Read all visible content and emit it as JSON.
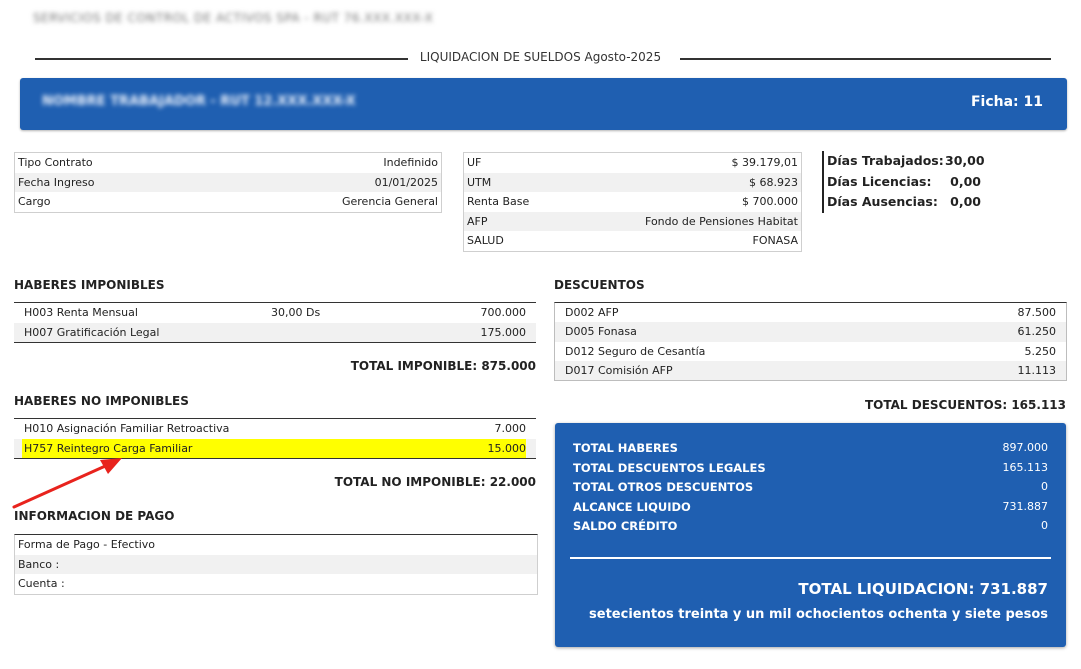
{
  "header": {
    "company_line": "SERVICIOS DE CONTROL DE ACTIVOS SPA - RUT 76.XXX.XXX-X",
    "document_title": "LIQUIDACION DE SUELDOS Agosto-2025"
  },
  "employee": {
    "name": "NOMBRE TRABAJADOR - RUT 12.XXX.XXX-X",
    "ficha_label": "Ficha:",
    "ficha_value": "11"
  },
  "contract_info": [
    {
      "label": "Tipo Contrato",
      "value": "Indefinido"
    },
    {
      "label": "Fecha Ingreso",
      "value": "01/01/2025"
    },
    {
      "label": "Cargo",
      "value": "Gerencia General"
    }
  ],
  "indicators": [
    {
      "label": "UF",
      "value": "$ 39.179,01"
    },
    {
      "label": "UTM",
      "value": "$ 68.923"
    },
    {
      "label": "Renta Base",
      "value": "$ 700.000"
    },
    {
      "label": "AFP",
      "value": "Fondo de Pensiones Habitat"
    },
    {
      "label": "SALUD",
      "value": "FONASA"
    }
  ],
  "days": [
    {
      "label": "Días Trabajados:",
      "value": "30,00"
    },
    {
      "label": "Días Licencias:",
      "value": "0,00"
    },
    {
      "label": "Días Ausencias:",
      "value": "0,00"
    }
  ],
  "haberes_imponibles": {
    "title": "HABERES IMPONIBLES",
    "rows": [
      {
        "name": "H003 Renta Mensual",
        "qty": "30,00 Ds",
        "amount": "700.000"
      },
      {
        "name": "H007 Gratificación Legal",
        "qty": "",
        "amount": "175.000"
      }
    ],
    "total": "TOTAL IMPONIBLE: 875.000"
  },
  "haberes_no_imponibles": {
    "title": "HABERES NO IMPONIBLES",
    "rows": [
      {
        "name": "H010 Asignación Familiar Retroactiva",
        "amount": "7.000"
      },
      {
        "name": "H757 Reintegro Carga Familiar",
        "amount": "15.000"
      }
    ],
    "total": "TOTAL NO IMPONIBLE: 22.000"
  },
  "pago": {
    "title": "INFORMACION DE PAGO",
    "rows": [
      "Forma de Pago - Efectivo",
      "Banco :",
      "Cuenta :"
    ]
  },
  "descuentos": {
    "title": "DESCUENTOS",
    "rows": [
      {
        "name": "D002 AFP",
        "amount": "87.500"
      },
      {
        "name": "D005 Fonasa",
        "amount": "61.250"
      },
      {
        "name": "D012 Seguro de Cesantía",
        "amount": "5.250"
      },
      {
        "name": "D017 Comisión AFP",
        "amount": "11.113"
      }
    ],
    "total": "TOTAL DESCUENTOS: 165.113"
  },
  "summary": {
    "rows": [
      {
        "label": "TOTAL HABERES",
        "value": "897.000"
      },
      {
        "label": "TOTAL DESCUENTOS LEGALES",
        "value": "165.113"
      },
      {
        "label": "TOTAL OTROS DESCUENTOS",
        "value": "0"
      },
      {
        "label": "ALCANCE LIQUIDO",
        "value": "731.887"
      },
      {
        "label": "SALDO CRÉDITO",
        "value": "0"
      }
    ],
    "total_liquidacion": "TOTAL LIQUIDACION: 731.887",
    "amount_words": "setecientos treinta y un mil ochocientos ochenta y siete pesos"
  },
  "colors": {
    "brand_blue": "#1f5fb1",
    "highlight": "#ffff00",
    "annotation_arrow": "#e8231d"
  }
}
